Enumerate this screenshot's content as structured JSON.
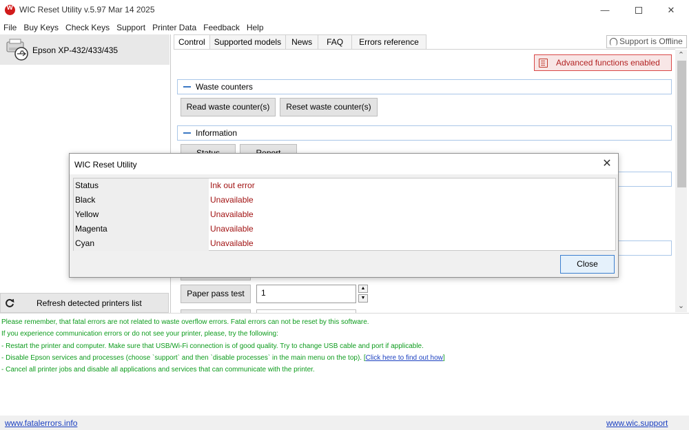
{
  "window": {
    "title": "WIC Reset Utility v.5.97 Mar 14 2025",
    "minimize_glyph": "—",
    "close_glyph": "✕"
  },
  "menu": {
    "items": [
      "File",
      "Buy Keys",
      "Check Keys",
      "Support",
      "Printer Data",
      "Feedback",
      "Help"
    ]
  },
  "left_panel": {
    "printer_name": "Epson XP-432/433/435",
    "refresh_label": "Refresh detected printers list"
  },
  "tabs": {
    "items": [
      "Control",
      "Supported models",
      "News",
      "FAQ",
      "Errors reference"
    ],
    "active": "Control"
  },
  "support_status": "Support is Offline",
  "control": {
    "advanced_label": "Advanced functions enabled",
    "waste_section": "Waste counters",
    "read_waste": "Read waste counter(s)",
    "reset_waste": "Reset waste counter(s)",
    "info_section": "Information",
    "status_btn": "Status",
    "report_btn": "Report",
    "paper_pass_label": "Paper pass test",
    "paper_pass_value": "1"
  },
  "info_messages": {
    "line1": "Please remember, that fatal errors are not related to waste overflow errors. Fatal errors can not be reset by this software.",
    "line2": "If you experience communication errors or do not see your printer, please, try the following:",
    "line3": "- Restart the printer and computer. Make sure that USB/Wi-Fi connection is of good quality. Try to change USB cable and port if applicable.",
    "line4_prefix": "- Disable Epson services and processes (choose `support` and then `disable processes` in the main menu on the top). [",
    "line4_link": "Click here to find out how",
    "line4_suffix": "]",
    "line5": "- Cancel all printer jobs  and disable all applications and services that can communicate with the printer."
  },
  "footer": {
    "left_link": "www.fatalerrors.info",
    "right_link": "www.wic.support"
  },
  "dialog": {
    "title": "WIC Reset Utility",
    "close_glyph": "✕",
    "rows": [
      {
        "label": "Status",
        "value": "Ink out error"
      },
      {
        "label": "Black",
        "value": "Unavailable"
      },
      {
        "label": "Yellow",
        "value": "Unavailable"
      },
      {
        "label": "Magenta",
        "value": "Unavailable"
      },
      {
        "label": "Cyan",
        "value": "Unavailable"
      }
    ],
    "close_button": "Close"
  },
  "colors": {
    "error_text": "#a11212",
    "info_text": "#0c9b1c",
    "link": "#1a3fc0",
    "advanced_border": "#d94646"
  }
}
